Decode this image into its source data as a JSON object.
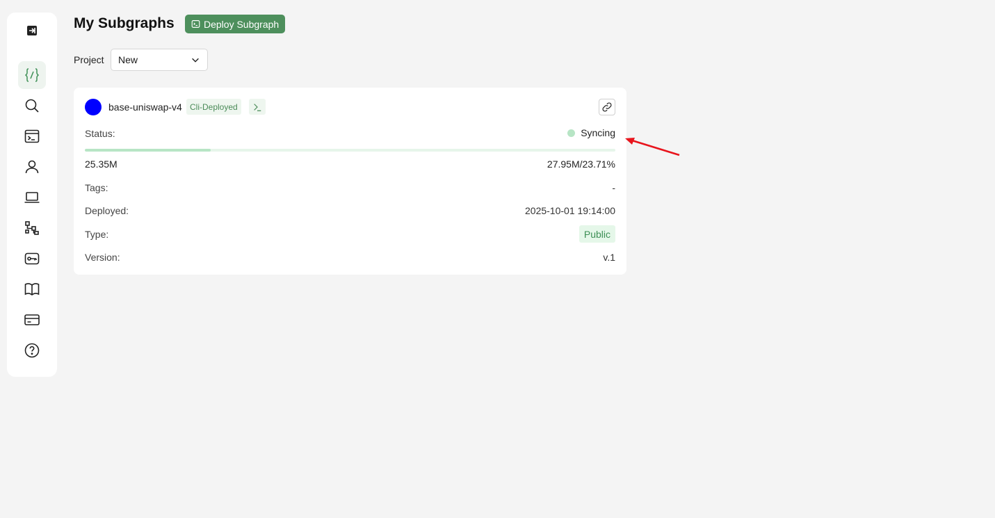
{
  "header": {
    "title": "My Subgraphs",
    "deploy_label": "Deploy Subgraph"
  },
  "filter": {
    "project_label": "Project",
    "project_value": "New"
  },
  "subgraph": {
    "name": "base-uniswap-v4",
    "deploy_badge": "Cli-Deployed",
    "avatar_color": "#0000ff",
    "status_label": "Status:",
    "status_value": "Syncing",
    "progress_percent": 23.71,
    "blocks_current": "25.35M",
    "blocks_total": "27.95M/23.71%",
    "tags_label": "Tags:",
    "tags_value": "-",
    "deployed_label": "Deployed:",
    "deployed_value": "2025-10-01 19:14:00",
    "type_label": "Type:",
    "type_value": "Public",
    "version_label": "Version:",
    "version_value": "v.1"
  },
  "sidebar": {
    "icons": [
      "collapse-icon",
      "code-braces-icon",
      "search-icon",
      "terminal-window-icon",
      "user-icon",
      "laptop-icon",
      "workflow-icon",
      "key-icon",
      "book-icon",
      "credit-card-icon",
      "help-icon"
    ]
  },
  "colors": {
    "accent": "#4d8f5c",
    "sync_dot": "#b7e5c5",
    "annotation_arrow": "#e8141c"
  }
}
